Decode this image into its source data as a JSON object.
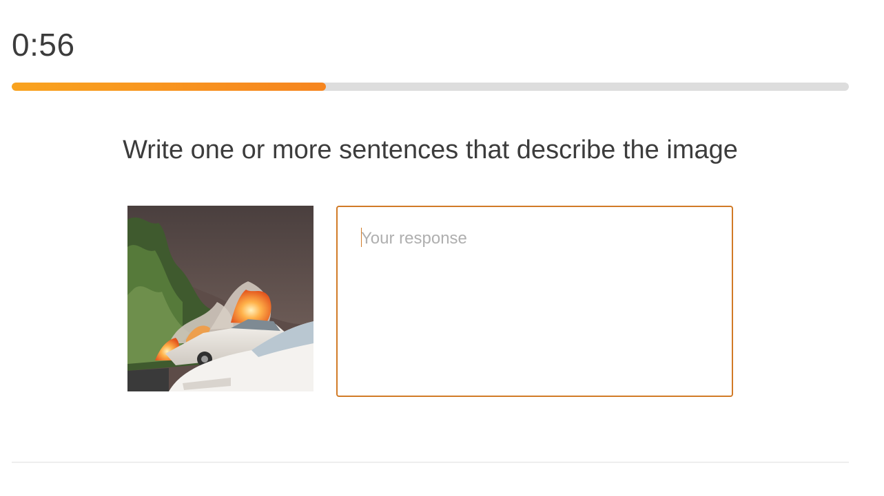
{
  "timer": {
    "text": "0:56"
  },
  "progress": {
    "fraction": 0.375,
    "colors": {
      "start": "#f9a31f",
      "end": "#f6851f",
      "track": "#dddddd"
    }
  },
  "challenge": {
    "prompt": "Write one or more sentences that describe the image"
  },
  "image": {
    "icon": "photo-burning-car"
  },
  "response": {
    "placeholder": "Your response",
    "value": ""
  },
  "colors": {
    "accent": "#d17a26",
    "text": "#3c3c3c",
    "placeholder": "#afafaf"
  }
}
